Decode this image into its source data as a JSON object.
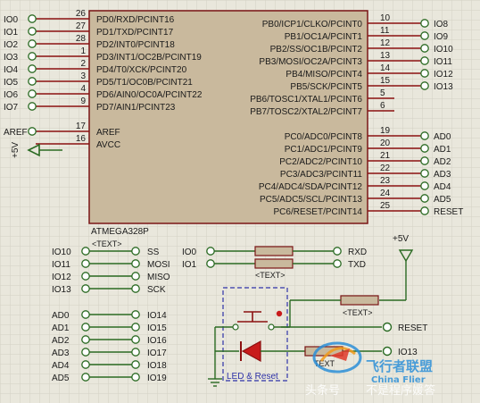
{
  "chip": {
    "name": "ATMEGA328P",
    "text_placeholder": "<TEXT>",
    "left_pins": [
      {
        "num": "26",
        "label": "PD0/RXD/PCINT16",
        "net": "IO0"
      },
      {
        "num": "27",
        "label": "PD1/TXD/PCINT17",
        "net": "IO1"
      },
      {
        "num": "28",
        "label": "PD2/INT0/PCINT18",
        "net": "IO2"
      },
      {
        "num": "1",
        "label": "PD3/INT1/OC2B/PCINT19",
        "net": "IO3"
      },
      {
        "num": "2",
        "label": "PD4/T0/XCK/PCINT20",
        "net": "IO4"
      },
      {
        "num": "3",
        "label": "PD5/T1/OC0B/PCINT21",
        "net": "IO5"
      },
      {
        "num": "4",
        "label": "PD6/AIN0/OC0A/PCINT22",
        "net": "IO6"
      },
      {
        "num": "9",
        "label": "PD7/AIN1/PCINT23",
        "net": "IO7"
      },
      {
        "num": "17",
        "label": "AREF",
        "net": "AREF"
      },
      {
        "num": "16",
        "label": "AVCC",
        "net": "+5V"
      }
    ],
    "right_pins": [
      {
        "num": "10",
        "label": "PB0/ICP1/CLKO/PCINT0",
        "net": "IO8"
      },
      {
        "num": "11",
        "label": "PB1/OC1A/PCINT1",
        "net": "IO9"
      },
      {
        "num": "12",
        "label": "PB2/SS/OC1B/PCINT2",
        "net": "IO10"
      },
      {
        "num": "13",
        "label": "PB3/MOSI/OC2A/PCINT3",
        "net": "IO11"
      },
      {
        "num": "14",
        "label": "PB4/MISO/PCINT4",
        "net": "IO12"
      },
      {
        "num": "15",
        "label": "PB5/SCK/PCINT5",
        "net": "IO13"
      },
      {
        "num": "5",
        "label": "PB6/TOSC1/XTAL1/PCINT6",
        "net": ""
      },
      {
        "num": "6",
        "label": "PB7/TOSC2/XTAL2/PCINT7",
        "net": ""
      },
      {
        "num": "19",
        "label": "PC0/ADC0/PCINT8",
        "net": "AD0"
      },
      {
        "num": "20",
        "label": "PC1/ADC1/PCINT9",
        "net": "AD1"
      },
      {
        "num": "21",
        "label": "PC2/ADC2/PCINT10",
        "net": "AD2"
      },
      {
        "num": "22",
        "label": "PC3/ADC3/PCINT11",
        "net": "AD3"
      },
      {
        "num": "23",
        "label": "PC4/ADC4/SDA/PCINT12",
        "net": "AD4"
      },
      {
        "num": "24",
        "label": "PC5/ADC5/SCL/PCINT13",
        "net": "AD5"
      },
      {
        "num": "25",
        "label": "PC6/RESET/PCINT14",
        "net": "RESET"
      }
    ]
  },
  "spi_map": [
    {
      "from": "IO10",
      "to": "SS"
    },
    {
      "from": "IO11",
      "to": "MOSI"
    },
    {
      "from": "IO12",
      "to": "MISO"
    },
    {
      "from": "IO13",
      "to": "SCK"
    }
  ],
  "serial_map": [
    {
      "from": "IO0",
      "to": "RXD"
    },
    {
      "from": "IO1",
      "to": "TXD"
    }
  ],
  "serial_text": "<TEXT>",
  "analog_map": [
    {
      "from": "AD0",
      "to": "IO14"
    },
    {
      "from": "AD1",
      "to": "IO15"
    },
    {
      "from": "AD2",
      "to": "IO16"
    },
    {
      "from": "AD3",
      "to": "IO17"
    },
    {
      "from": "AD4",
      "to": "IO18"
    },
    {
      "from": "AD5",
      "to": "IO19"
    }
  ],
  "reset_circuit": {
    "supply": "+5V",
    "reset_net": "RESET",
    "led_net": "IO13",
    "resistor_text": "<TEXT>",
    "led_text": "TEXT",
    "group_label": "LED & Reset"
  },
  "watermark": {
    "left": "头条号",
    "middle": "不是程序媛答",
    "brand_cn": "飞行者联盟",
    "brand_en": "China Flier"
  },
  "colors": {
    "background": "#e9e7dc",
    "chip_fill": "#c9b99d",
    "wire": "#2a6a22",
    "component": "#8b1010",
    "text": "#1a1a1a",
    "group_box": "#2f33a8"
  }
}
